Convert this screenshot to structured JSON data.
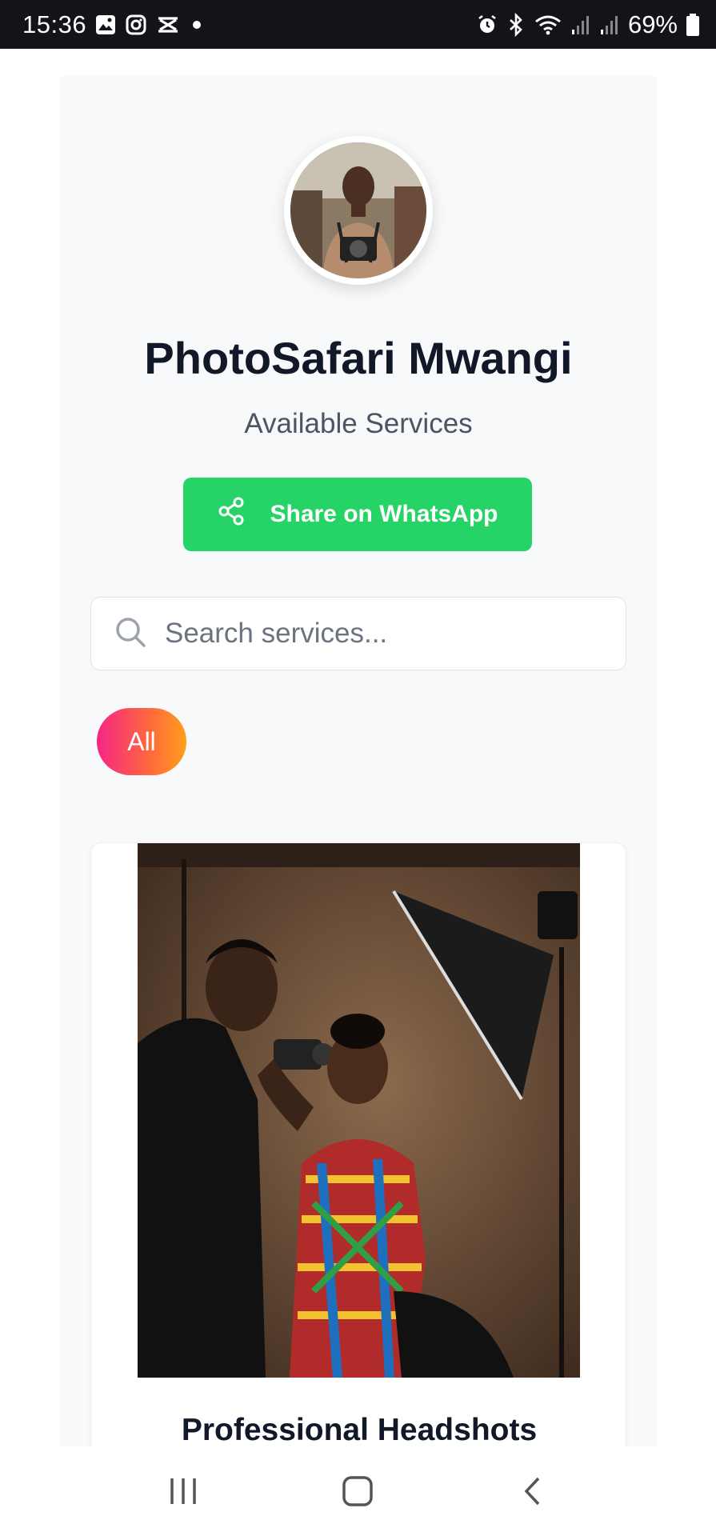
{
  "status_bar": {
    "time": "15:36",
    "battery": "69%",
    "left_icons": [
      "gallery-icon",
      "instagram-icon",
      "capcut-icon",
      "dot-icon"
    ],
    "right_icons": [
      "alarm-icon",
      "bluetooth-icon",
      "wifi-icon",
      "signal-icon",
      "signal-icon",
      "battery-icon"
    ]
  },
  "profile": {
    "name": "PhotoSafari Mwangi",
    "subtitle": "Available Services",
    "avatar_icon": "photographer-avatar"
  },
  "share": {
    "label": "Share on WhatsApp",
    "icon": "share-icon",
    "color": "#25d366"
  },
  "search": {
    "placeholder": "Search services...",
    "value": "",
    "icon": "search-icon"
  },
  "filters": [
    {
      "label": "All",
      "active": true
    }
  ],
  "services": [
    {
      "title": "Professional Headshots",
      "image": "photographer-studio-photo"
    }
  ],
  "nav": {
    "recents_icon": "recents-icon",
    "home_icon": "home-icon",
    "back_icon": "back-icon"
  },
  "colors": {
    "status_bar_bg": "#121419",
    "page_bg": "#f8f9fb",
    "filter_gradient_start": "#f72585",
    "filter_gradient_end": "#ff9f1c",
    "whatsapp_green": "#25d366"
  }
}
